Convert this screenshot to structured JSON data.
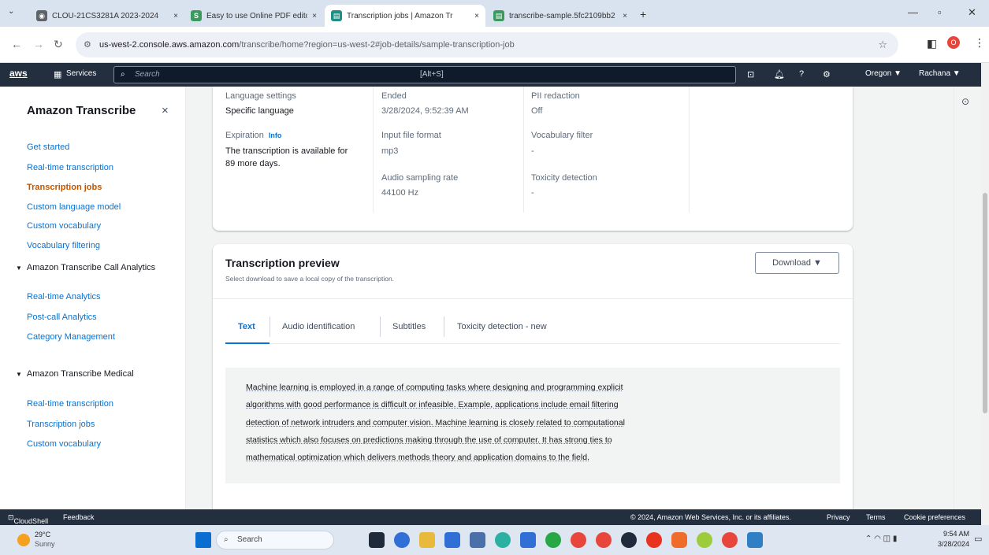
{
  "browser": {
    "tabs": [
      {
        "title": "CLOU-21CS3281A 2023-2024",
        "close": "×",
        "color": "#5f6368",
        "active": false
      },
      {
        "title": "Easy to use Online PDF editor",
        "close": "×",
        "color": "#3c9a5f",
        "active": false
      },
      {
        "title": "Transcription jobs | Amazon Tr",
        "close": "×",
        "color": "#1f8f86",
        "active": true
      },
      {
        "title": "transcribe-sample.5fc2109bb2",
        "close": "×",
        "color": "#3c9a5f",
        "active": false
      }
    ],
    "new_tab": "+",
    "url_host": "us-west-2.console.aws.amazon.com",
    "url_path": "/transcribe/home?region=us-west-2#job-details/sample-transcription-job"
  },
  "aws_header": {
    "logo": "aws",
    "services": "Services",
    "search_placeholder": "Search",
    "shortcut": "[Alt+S]",
    "region": "Oregon ▼",
    "user": "Rachana ▼"
  },
  "sidebar": {
    "title": "Amazon Transcribe",
    "close": "×",
    "items": [
      {
        "label": "Get started"
      },
      {
        "label": "Real-time transcription"
      },
      {
        "label": "Transcription jobs",
        "active": true
      },
      {
        "label": "Custom language model"
      },
      {
        "label": "Custom vocabulary"
      },
      {
        "label": "Vocabulary filtering"
      }
    ],
    "call_analytics": {
      "title": "Amazon Transcribe Call Analytics",
      "items": [
        "Real-time Analytics",
        "Post-call Analytics",
        "Category Management"
      ]
    },
    "medical": {
      "title": "Amazon Transcribe Medical",
      "items": [
        "Real-time transcription",
        "Transcription jobs",
        "Custom vocabulary"
      ]
    }
  },
  "details": {
    "language_settings_label": "Language settings",
    "language_settings_value": "Specific language",
    "ended_label": "Ended",
    "ended_value": "3/28/2024, 9:52:39 AM",
    "pii_label": "PII redaction",
    "pii_value": "Off",
    "expiration_label": "Expiration",
    "expiration_info": "Info",
    "expiration_value_1": "The transcription is available for",
    "expiration_value_2": "89 more days.",
    "input_format_label": "Input file format",
    "input_format_value": "mp3",
    "vocab_filter_label": "Vocabulary filter",
    "vocab_filter_value": "-",
    "sampling_label": "Audio sampling rate",
    "sampling_value": "44100 Hz",
    "toxicity_label": "Toxicity detection",
    "toxicity_value": "-"
  },
  "preview": {
    "title": "Transcription preview",
    "subtitle": "Select download to save a local copy of the transcription.",
    "download": "Download ▼",
    "tabs": [
      "Text",
      "Audio identification",
      "Subtitles",
      "Toxicity detection - new"
    ],
    "lines": [
      "Machine learning is employed in a range of computing tasks where designing and programming explicit",
      "algorithms with good performance is difficult or infeasible. Example, applications include email filtering",
      "detection of network intruders and computer vision. Machine learning is closely related to computational",
      "statistics which also focuses on predictions making through the use of computer. It has strong ties to",
      "mathematical optimization which delivers methods theory and application domains to the field."
    ]
  },
  "footer": {
    "cloudshell": "CloudShell",
    "feedback": "Feedback",
    "copyright": "© 2024, Amazon Web Services, Inc. or its affiliates.",
    "privacy": "Privacy",
    "terms": "Terms",
    "cookies": "Cookie preferences"
  },
  "taskbar": {
    "temp": "29°C",
    "weather": "Sunny",
    "search": "Search",
    "time": "9:54 AM",
    "date": "3/28/2024"
  }
}
